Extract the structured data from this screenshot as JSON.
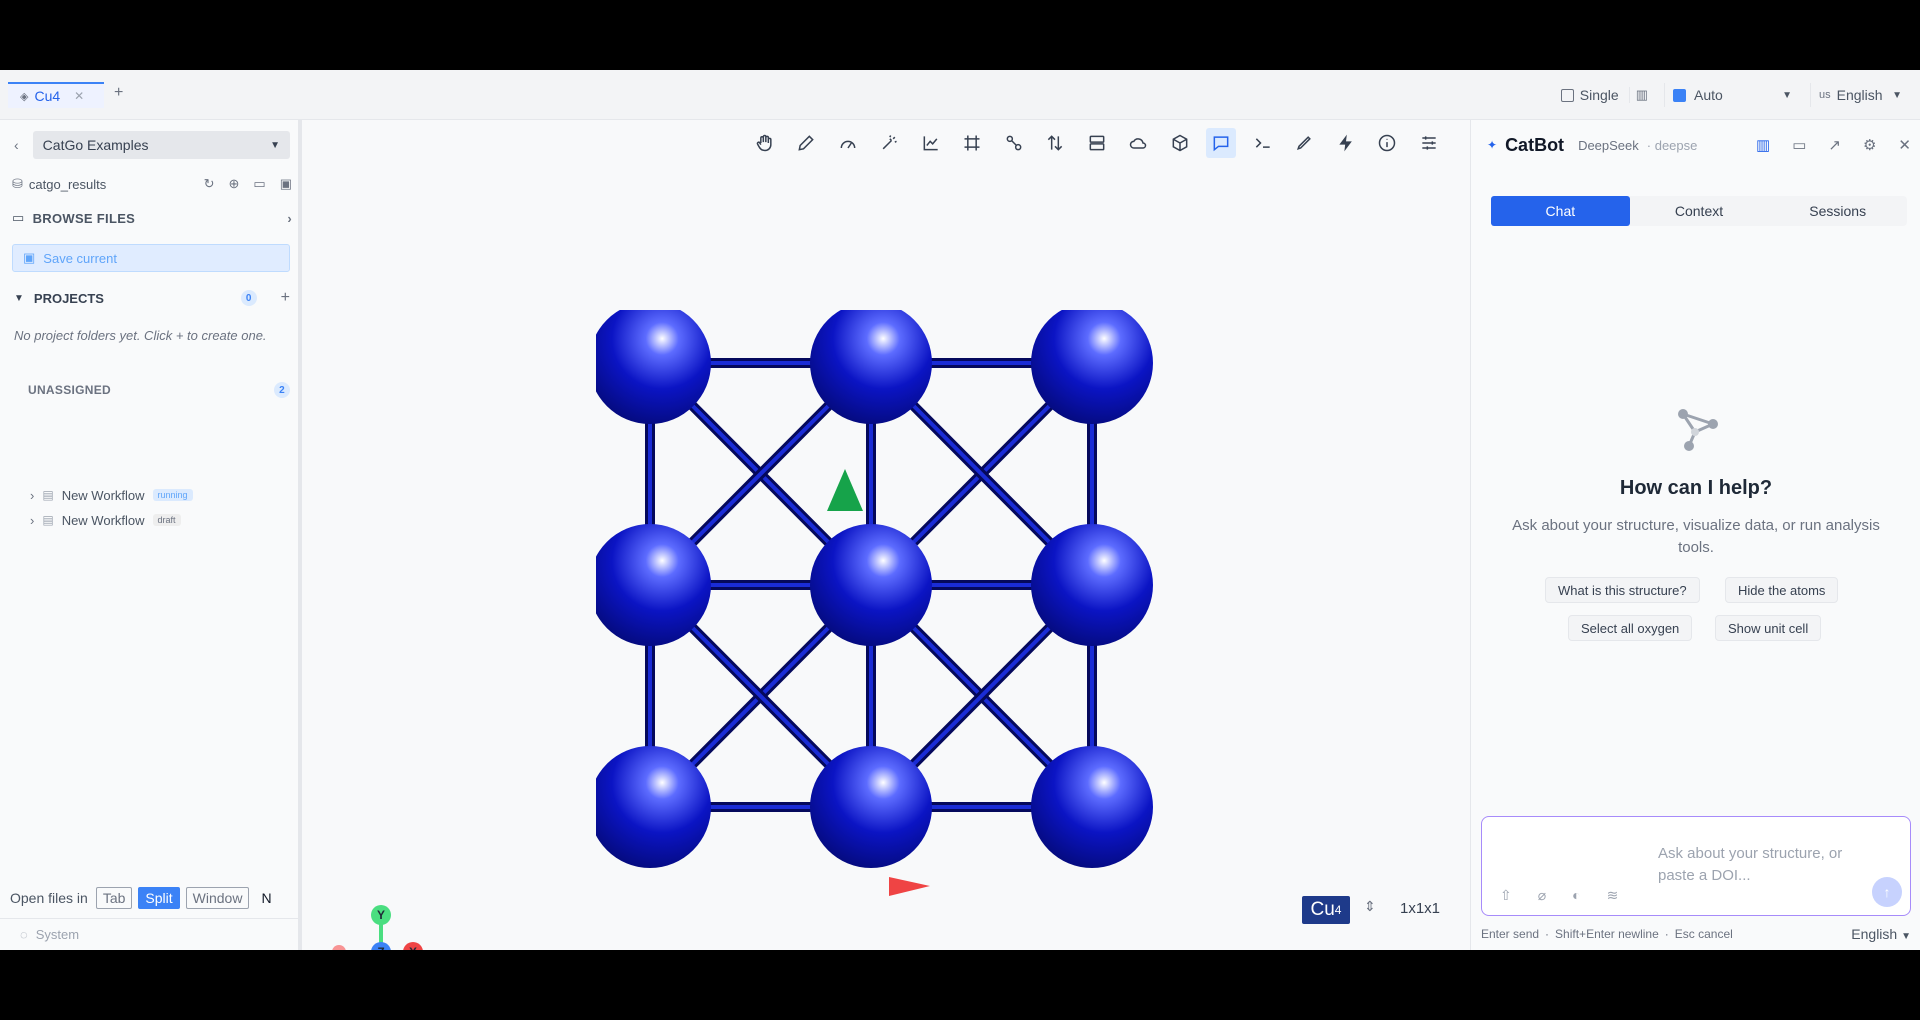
{
  "tabbar": {
    "tab_label": "Cu4",
    "single_label": "Single",
    "auto_label": "Auto",
    "lang_flag": "us",
    "lang_label": "English"
  },
  "sidebar": {
    "examples_select": "CatGo Examples",
    "results_folder": "catgo_results",
    "browse_files": "BROWSE FILES",
    "save_current": "Save current",
    "projects_label": "PROJECTS",
    "projects_count": "0",
    "empty_text": "No project folders yet. Click + to create one.",
    "unassigned_label": "UNASSIGNED",
    "unassigned_count": "2",
    "workflows": [
      {
        "name": "New Workflow",
        "status": "running"
      },
      {
        "name": "New Workflow",
        "status": "draft"
      }
    ],
    "open_files_in": "Open files in",
    "open_modes": [
      "Tab",
      "Split",
      "Window"
    ],
    "open_trailing": "N",
    "system_label": "System"
  },
  "viewer": {
    "formula_element": "Cu",
    "formula_count": "4",
    "supercell": "1x1x1",
    "axis_labels": {
      "x": "X",
      "y": "Y",
      "z": "Z"
    },
    "atom_color": "#0b14c4",
    "tools": [
      "hand-icon",
      "pencil-icon",
      "measure-icon",
      "magic-wand-icon",
      "chart-line-icon",
      "frame-icon",
      "bonds-icon",
      "sort-icon",
      "layers-icon",
      "cloud-icon",
      "cube-icon",
      "comment-icon",
      "terminal-icon",
      "brush-icon",
      "lightning-icon",
      "info-icon",
      "sliders-icon"
    ]
  },
  "catbot": {
    "title": "CatBot",
    "model": "DeepSeek",
    "model_detail": "· deepse",
    "tabs": [
      "Chat",
      "Context",
      "Sessions"
    ],
    "help_title": "How can I help?",
    "help_sub": "Ask about your structure, visualize data, or run analysis tools.",
    "suggestions": [
      "What is this structure?",
      "Hide the atoms",
      "Select all oxygen",
      "Show unit cell"
    ],
    "input_placeholder": "Ask about your structure, or paste a DOI...",
    "foot_send": "Enter send",
    "foot_newline": "Shift+Enter newline",
    "foot_cancel": "Esc cancel",
    "foot_lang": "English",
    "accent": "#2563eb"
  }
}
